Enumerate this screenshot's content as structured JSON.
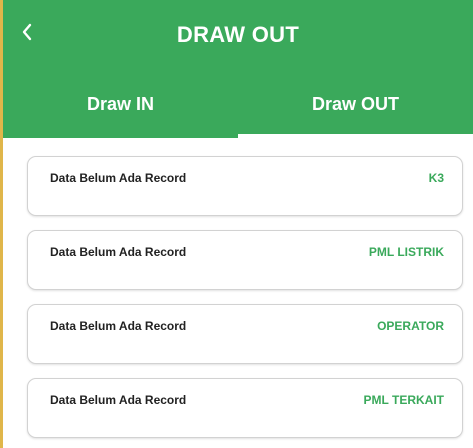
{
  "header": {
    "title": "DRAW OUT",
    "back_icon": "chevron-left-icon"
  },
  "tabs": [
    {
      "label": "Draw IN",
      "active": false
    },
    {
      "label": "Draw OUT",
      "active": true
    }
  ],
  "records": [
    {
      "status": "Data Belum Ada Record",
      "category": "K3"
    },
    {
      "status": "Data Belum Ada Record",
      "category": "PML LISTRIK"
    },
    {
      "status": "Data Belum Ada Record",
      "category": "OPERATOR"
    },
    {
      "status": "Data Belum Ada Record",
      "category": "PML TERKAIT"
    }
  ],
  "colors": {
    "primary": "#3aa95b",
    "accent_text": "#3aa95b",
    "card_text": "#222222"
  }
}
